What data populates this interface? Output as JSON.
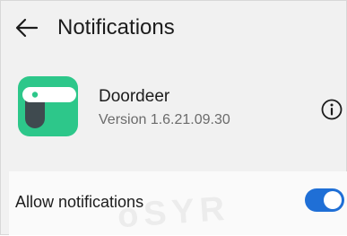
{
  "header": {
    "title": "Notifications",
    "back_icon": "arrow-left-icon"
  },
  "app": {
    "name": "Doordeer",
    "version": "Version 1.6.21.09.30",
    "icon": "door-handle-icon",
    "icon_color": "#2dc78a",
    "info_icon": "info-icon"
  },
  "settings": {
    "allow_notifications_label": "Allow notifications",
    "allow_notifications_enabled": true,
    "toggle_color": "#1f6fd6"
  }
}
